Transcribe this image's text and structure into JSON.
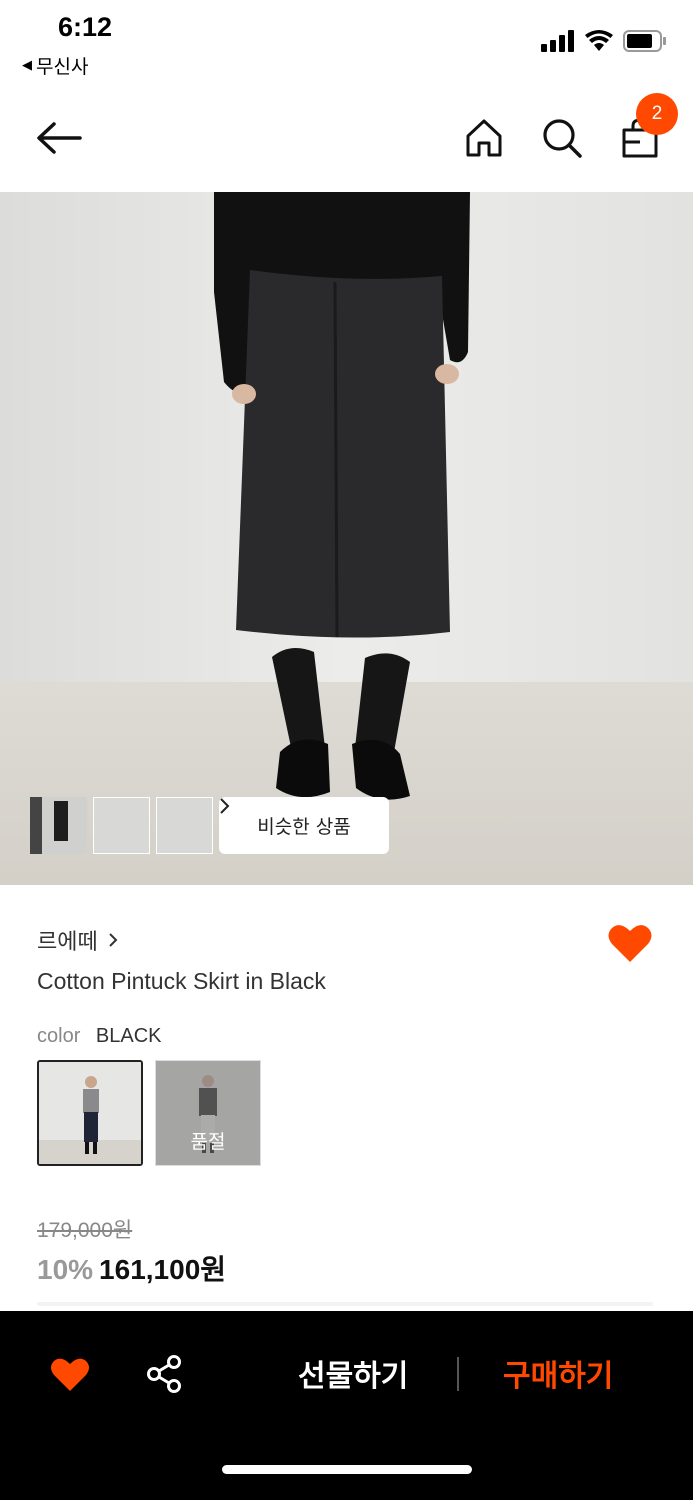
{
  "status": {
    "time": "6:12",
    "back_app": "무신사"
  },
  "nav": {
    "cart_count": "2"
  },
  "hero": {
    "similar_label": "비슷한 상품",
    "thumb_count": 3
  },
  "product": {
    "brand": "르에떼",
    "name": "Cotton Pintuck Skirt in Black",
    "color_label": "color",
    "color_value": "BLACK",
    "soldout_label": "품절",
    "original_price": "179,000원",
    "discount": "10%",
    "sale_price": "161,100원",
    "liked": true
  },
  "bottom_bar": {
    "gift_label": "선물하기",
    "buy_label": "구매하기"
  },
  "colors": {
    "accent": "#ff4800",
    "bottom_bar_bg": "#000000"
  },
  "icons": [
    "back-arrow-icon",
    "home-icon",
    "search-icon",
    "shopping-bag-icon",
    "heart-icon",
    "share-icon",
    "chevron-right-icon"
  ]
}
